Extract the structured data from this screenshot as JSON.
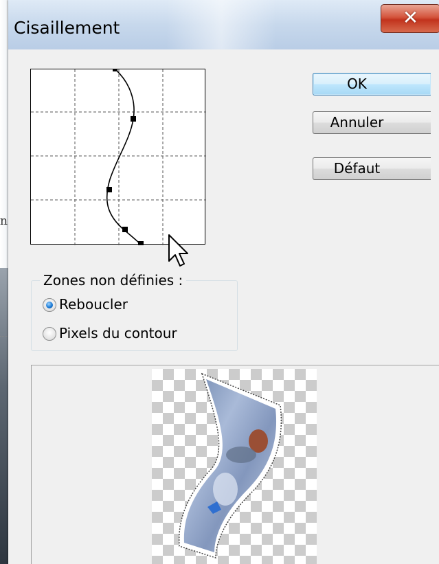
{
  "dialog": {
    "title": "Cisaillement",
    "close_glyph": "✕"
  },
  "background": {
    "edge_text": "n"
  },
  "buttons": {
    "ok_label": "OK",
    "cancel_label": "Annuler",
    "default_label": "Défaut"
  },
  "undefined_areas": {
    "label": "Zones non définies :",
    "options": [
      {
        "label": "Reboucler",
        "selected": true
      },
      {
        "label": "Pixels du contour",
        "selected": false
      }
    ]
  },
  "icons": {
    "close": "close-icon",
    "cursor": "arrow-cursor-icon",
    "curve_point": "control-point"
  },
  "colors": {
    "ok_accent": "#3c7fb1",
    "close_red": "#c2331d",
    "radio_selected": "#1b7ad6"
  }
}
